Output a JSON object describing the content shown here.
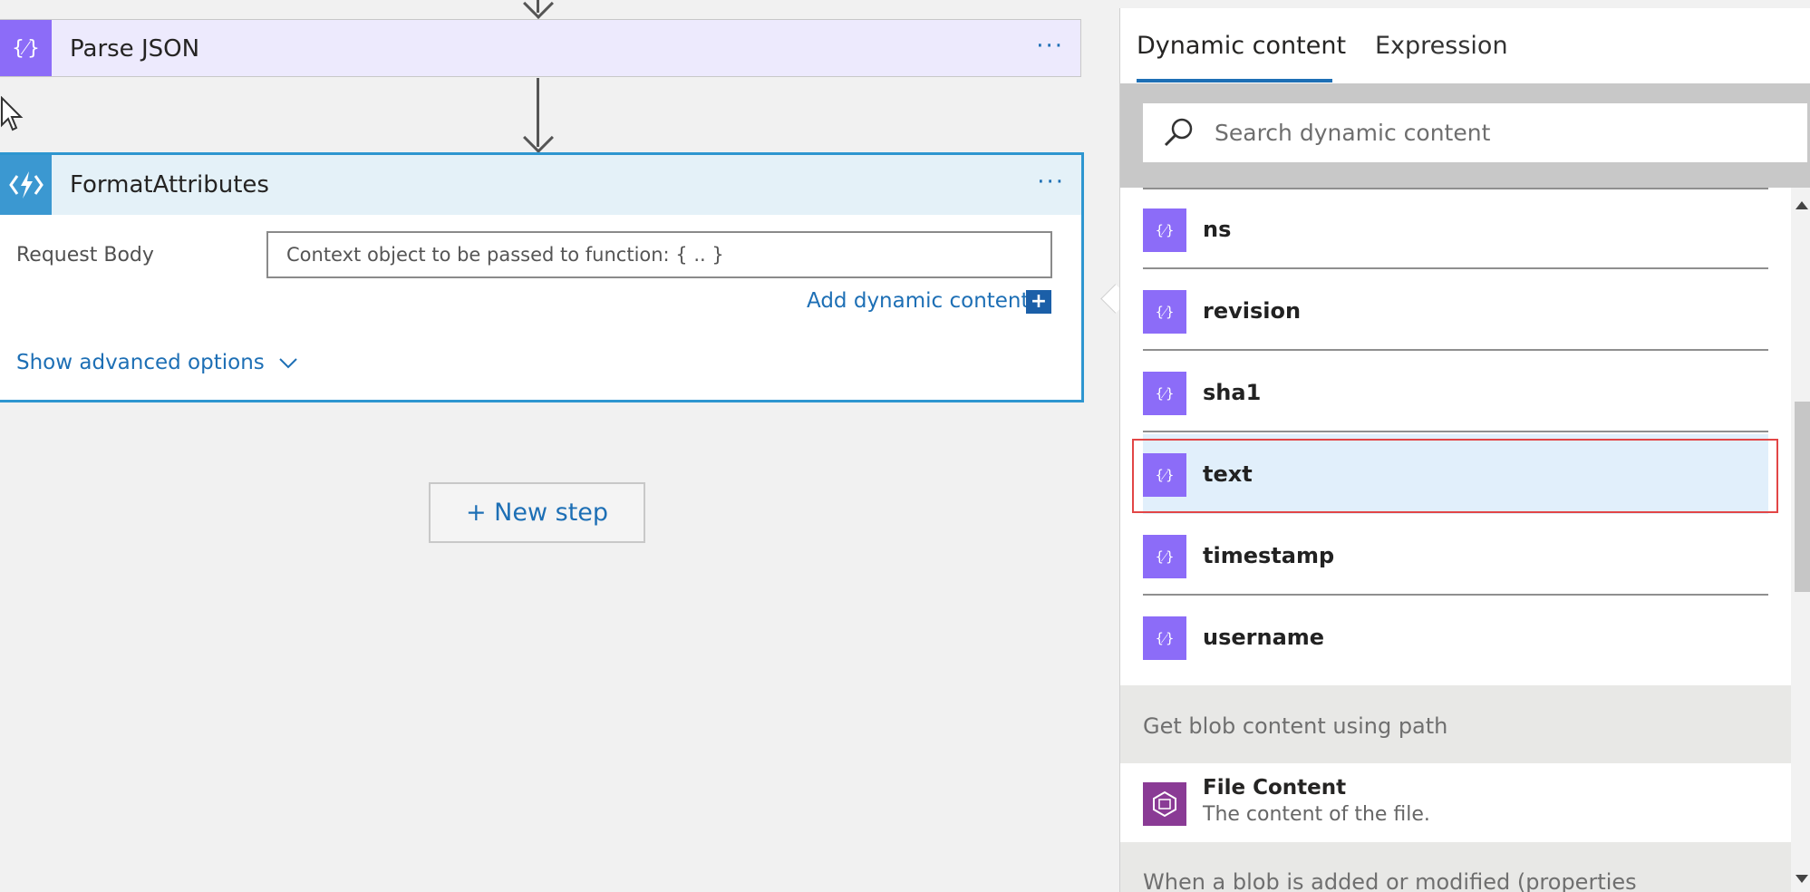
{
  "flow": {
    "parse_card": {
      "title": "Parse JSON",
      "more": "···",
      "icon": "braces-icon"
    },
    "format_card": {
      "title": "FormatAttributes",
      "more": "···",
      "icon": "lightning-function-icon",
      "request_body_label": "Request Body",
      "request_body_placeholder": "Context object to be passed to function: { .. }",
      "add_dynamic_label": "Add dynamic content",
      "add_dynamic_icon": "+",
      "show_advanced_label": "Show advanced options"
    },
    "new_step_label": "+ New step"
  },
  "panel": {
    "tabs": {
      "dynamic": "Dynamic content",
      "expression": "Expression"
    },
    "search_placeholder": "Search dynamic content",
    "items": [
      {
        "label": "ns"
      },
      {
        "label": "revision"
      },
      {
        "label": "sha1"
      },
      {
        "label": "text"
      },
      {
        "label": "timestamp"
      },
      {
        "label": "username"
      }
    ],
    "highlighted_item": "text",
    "section_blob": "Get blob content using path",
    "file_item": {
      "title": "File Content",
      "description": "The content of the file."
    },
    "section_modified": "When a blob is added or modified (properties"
  },
  "colors": {
    "accent": "#1d6fb5",
    "parse_purple": "#8c6cf8",
    "function_blue": "#3b98d1",
    "highlight_border": "#e24646"
  }
}
